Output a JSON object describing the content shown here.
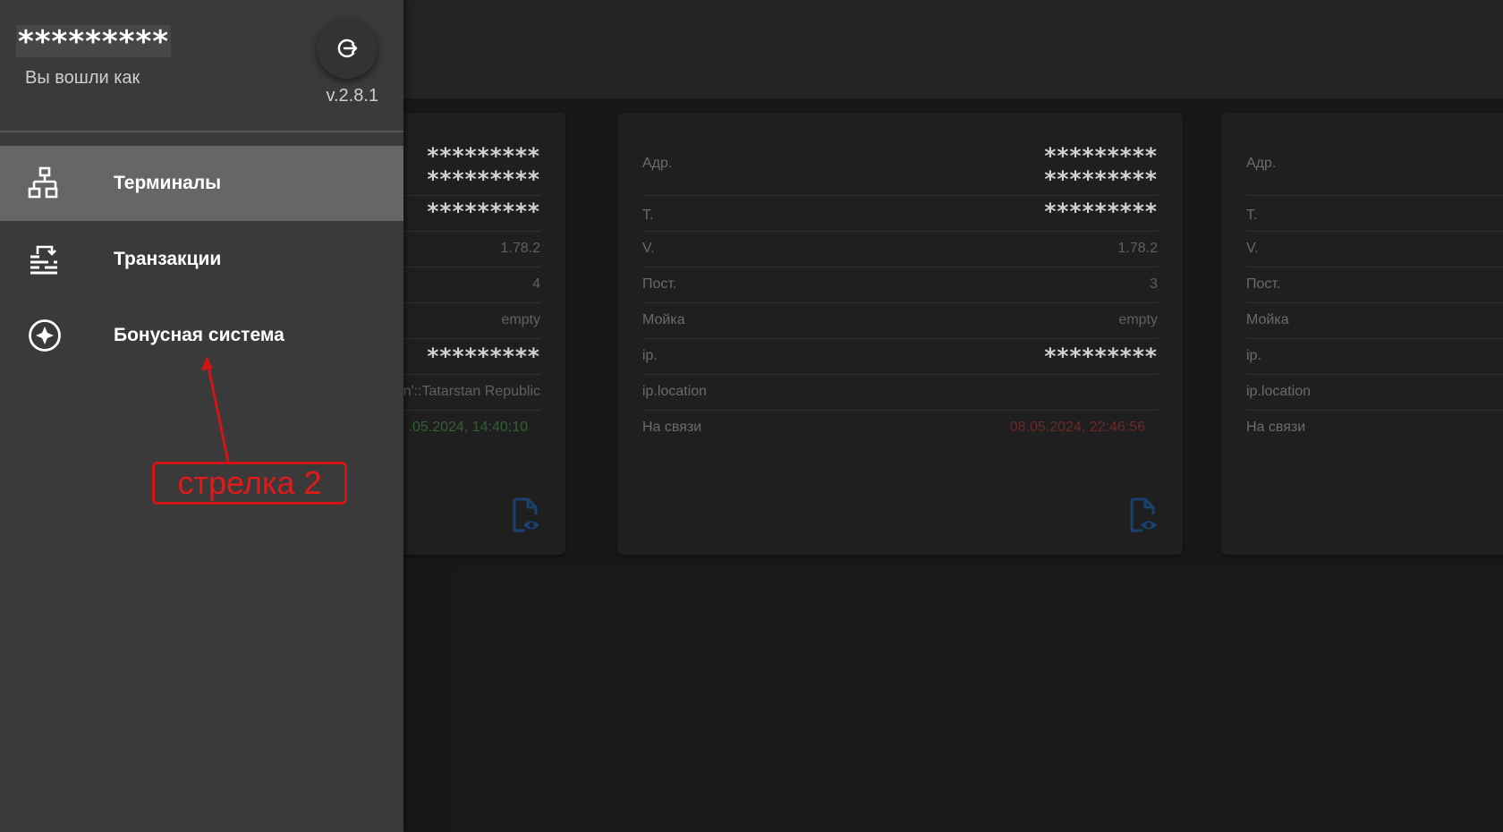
{
  "drawer": {
    "username": "*********",
    "logged_in_as": "Вы вошли как",
    "version": "v.2.8.1",
    "logout_icon": "logout-icon",
    "nav": [
      {
        "label": "Терминалы",
        "icon": "network-icon",
        "active": true
      },
      {
        "label": "Транзакции",
        "icon": "transactions-icon",
        "active": false
      },
      {
        "label": "Бонусная система",
        "icon": "compass-icon",
        "active": false
      }
    ]
  },
  "annotation": {
    "label": "стрелка 2",
    "color": "#d11414"
  },
  "cards": [
    {
      "address_line1": "*********",
      "address_line2": "*********",
      "t_value": "*********",
      "v_value": "1.78.2",
      "posts_value": "4",
      "wash_value": "empty",
      "ip_value": "*********",
      "location_value": "an'::Tatarstan Republic",
      "online_value": ".05.2024, 14:40:10",
      "online_color": "#3d6b3d"
    },
    {
      "address_label": "Адр.",
      "address_line1": "*********",
      "address_line2": "*********",
      "t_label": "Т.",
      "t_value": "*********",
      "v_label": "V.",
      "v_value": "1.78.2",
      "posts_label": "Пост.",
      "posts_value": "3",
      "wash_label": "Мойка",
      "wash_value": "empty",
      "ip_label": "ip.",
      "ip_value": "*********",
      "location_label": "ip.location",
      "online_label": "На связи",
      "online_value": "08.05.2024, 22:46:56",
      "online_color": "#7a2e2e"
    },
    {
      "address_label": "Адр.",
      "t_label": "Т.",
      "v_label": "V.",
      "posts_label": "Пост.",
      "wash_label": "Мойка",
      "ip_label": "ip.",
      "location_label": "ip.location",
      "online_label": "На связи"
    }
  ],
  "colors": {
    "background": "#1c1c1c",
    "drawer": "#3a3a3a",
    "active_item": "#666666",
    "doc_icon": "#1e4a80"
  }
}
